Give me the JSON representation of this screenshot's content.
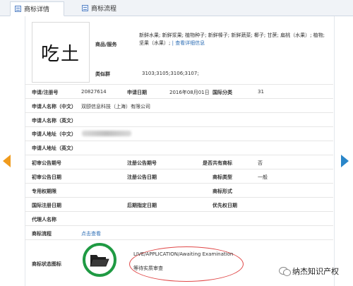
{
  "tabs": [
    {
      "label": "商标详情"
    },
    {
      "label": "商标流程"
    }
  ],
  "mark_image_text": "吃土",
  "goods_services": {
    "label": "商品/服务",
    "text": "新鲜水果; 新鲜浆果; 植物种子; 新鲜榛子; 新鲜蔬菜; 椰子; 甘蔗; 扁桃（水果）; 植物; 坚果（水果）;",
    "detail_link": "查看详细信息"
  },
  "similar_group": {
    "label": "类似群",
    "value": "3103;3105;3106;3107;"
  },
  "fields": {
    "reg_no_label": "申请/注册号",
    "reg_no": "20827614",
    "app_date_label": "申请日期",
    "app_date": "2016年08月01日",
    "intl_class_label": "国际分类",
    "intl_class": "31",
    "applicant_cn_label": "申请人名称（中文）",
    "applicant_cn": "双颐信息科技（上海）有限公司",
    "applicant_en_label": "申请人名称（英文）",
    "addr_cn_label": "申请人地址（中文）",
    "addr_en_label": "申请人地址（英文）",
    "prelim_no_label": "初审公告期号",
    "reg_notice_no_label": "注册公告期号",
    "shared_label": "是否共有商标",
    "shared": "否",
    "prelim_date_label": "初审公告日期",
    "reg_notice_date_label": "注册公告日期",
    "mark_type_label": "商标类型",
    "mark_type": "一般",
    "exclusive_period_label": "专用权期限",
    "mark_form_label": "商标形式",
    "intl_reg_date_label": "国际注册日期",
    "later_date_label": "后期指定日期",
    "priority_date_label": "优先权日期",
    "agent_label": "代理人名称",
    "process_label": "商标流程",
    "process_link": "点击查看",
    "status_icon_label": "商标状态图标"
  },
  "status": {
    "en": "LIVE/APPLICATION/Awaiting Examination",
    "cn": "等待实质审查"
  },
  "watermark": "纳杰知识产权",
  "colors": {
    "accent_left": "#f09b1d",
    "accent_right": "#2a86c9",
    "ring": "#1f9a43",
    "oval": "#e04848",
    "link": "#2f6fb6"
  }
}
